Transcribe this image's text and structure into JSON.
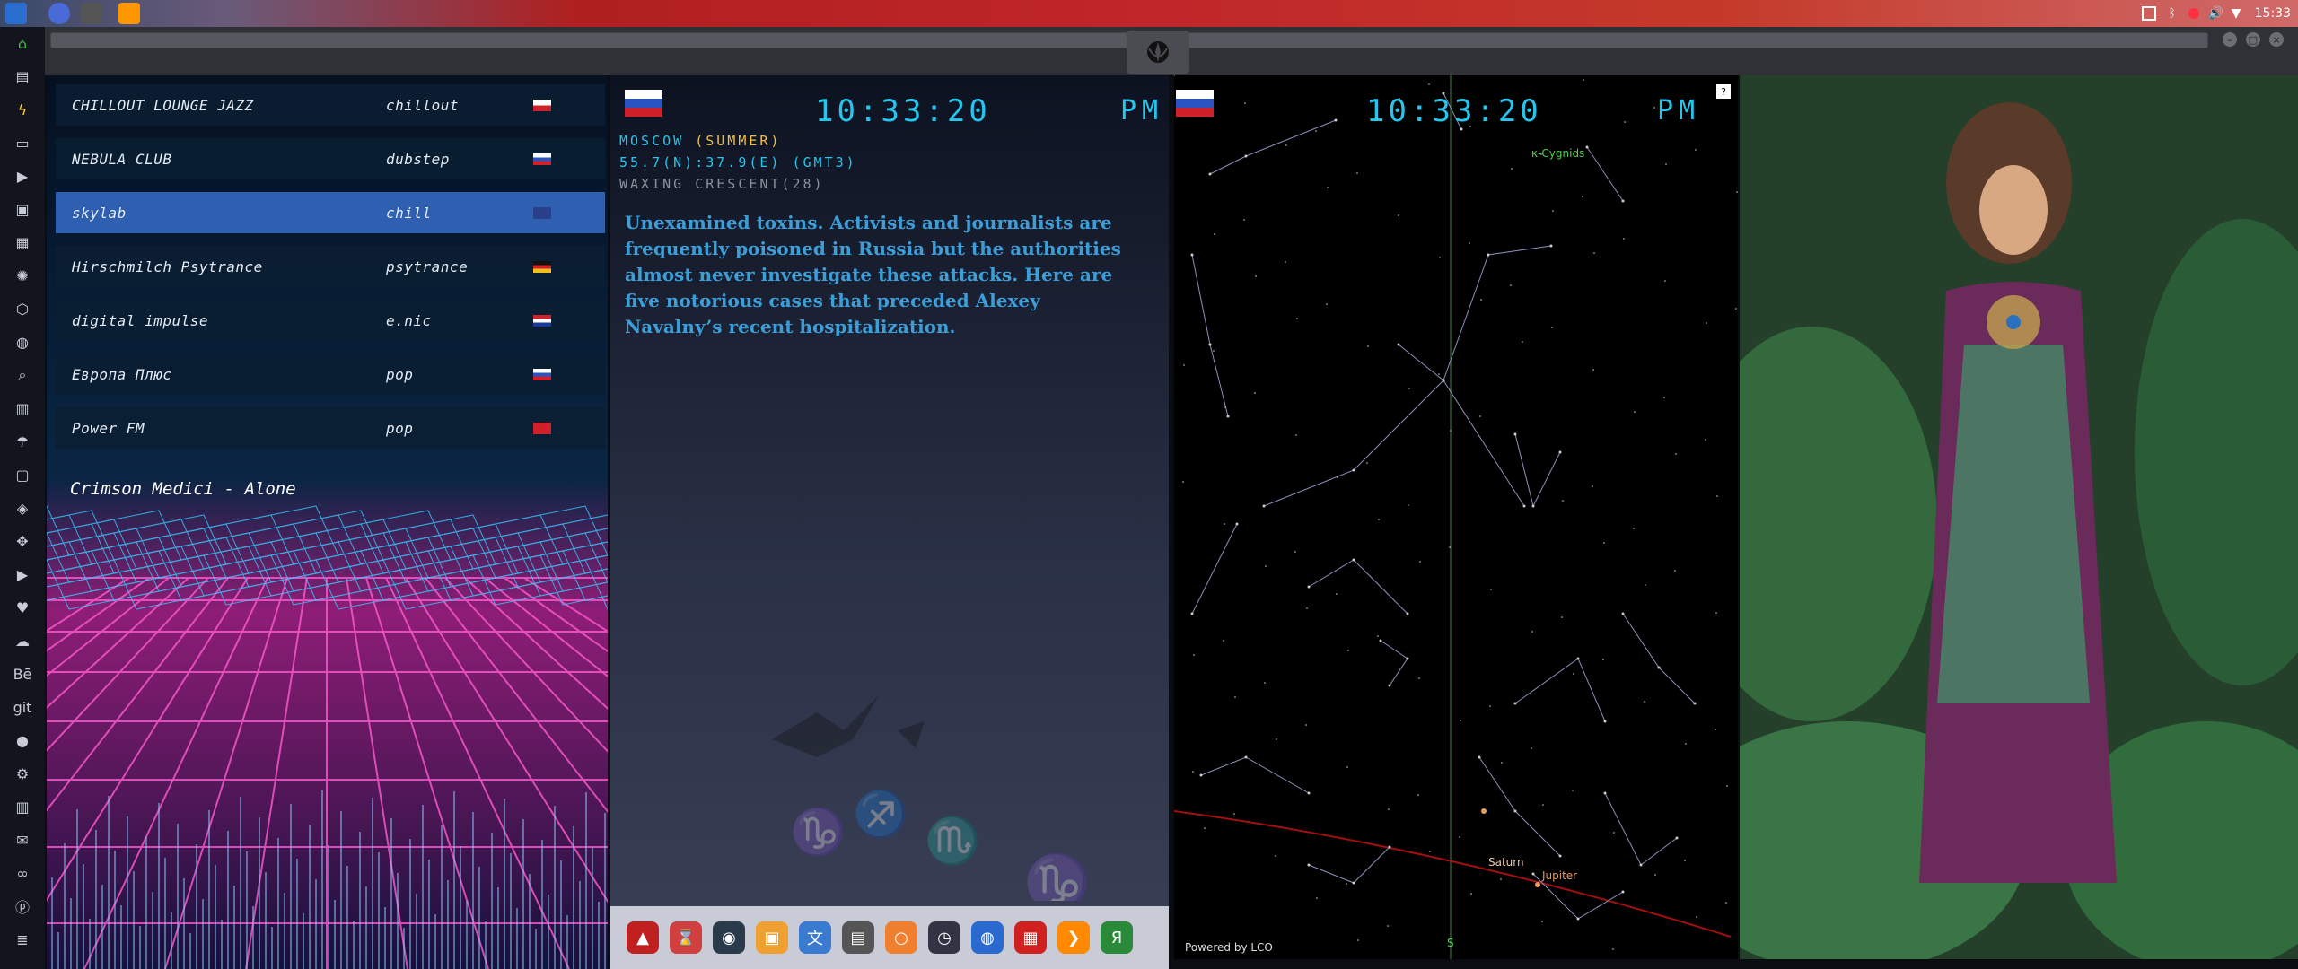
{
  "system": {
    "time": "15:33",
    "tray_icons": [
      "screenshot-icon",
      "bluetooth-icon",
      "record-icon",
      "volume-icon",
      "wifi-icon"
    ]
  },
  "top_apps": [
    "files-icon",
    "browser-icon",
    "terminal-icon",
    "sublime-icon"
  ],
  "left_dock": [
    "home-icon",
    "document-icon",
    "flash-icon",
    "archive-icon",
    "play-icon",
    "image-icon",
    "grid-icon",
    "settings-icon",
    "hexagon-icon",
    "globe-icon",
    "search-icon",
    "map-icon",
    "umbrella-icon",
    "contact-icon",
    "tag-icon",
    "expand-icon",
    "youtube-icon",
    "heart-icon",
    "cloud-icon",
    "behance-icon",
    "git-icon",
    "github-icon",
    "bike-icon",
    "map2-icon",
    "mail-icon",
    "link-icon",
    "pinterest-icon",
    "list-icon"
  ],
  "left_dock_labels": {
    "behance": "Bē",
    "git": "git"
  },
  "radio": {
    "stations": [
      {
        "name": "CHILLOUT LOUNGE JAZZ",
        "genre": "chillout",
        "flag": "ru-pl"
      },
      {
        "name": "NEBULA CLUB",
        "genre": "dubstep",
        "flag": "ru"
      },
      {
        "name": "skylab",
        "genre": "chill",
        "flag": "gb",
        "selected": true
      },
      {
        "name": "Hirschmilch Psytrance",
        "genre": "psytrance",
        "flag": "de"
      },
      {
        "name": "digital impulse",
        "genre": "e.nic",
        "flag": "hr"
      },
      {
        "name": "Европа Плюс",
        "genre": "pop",
        "flag": "ru"
      },
      {
        "name": "Power FM",
        "genre": "pop",
        "flag": "tr"
      }
    ],
    "now_playing": "Crimson Medici - Alone"
  },
  "clock1": {
    "time": "10:33:20",
    "ampm": "PM",
    "city_prefix": "MOSCOW ",
    "season": "(SUMMER)",
    "coords": "55.7(N):37.9(E) (GMT3)",
    "moon": "WAXING CRESCENT(28)",
    "headline": "Unexamined toxins. Activists and journalists are frequently poisoned in Russia but the authorities almost never investigate these attacks. Here are five notorious cases that preceded Alexey Navalny’s recent hospitalization."
  },
  "clock2": {
    "time": "10:33:20",
    "ampm": "PM"
  },
  "sky": {
    "labels": {
      "cygnids": "κ-Cygnids",
      "saturn": "Saturn",
      "jupiter": "Jupiter",
      "south": "S"
    },
    "powered_by": "Powered by LCO",
    "help": "?"
  },
  "dock_apps": [
    "adobe-icon",
    "hourglass-icon",
    "globe-dark-icon",
    "photos-icon",
    "translate-icon",
    "notes-icon",
    "search-app-icon",
    "clock-icon",
    "web-icon",
    "calendar-icon",
    "sublime-icon",
    "yandex-icon"
  ],
  "dock_yandex_label": "Я",
  "colors": {
    "accent": "#24c6ee",
    "selected_row": "#2e5fb0",
    "season": "#f0c040",
    "headline": "#3c9ed8"
  }
}
